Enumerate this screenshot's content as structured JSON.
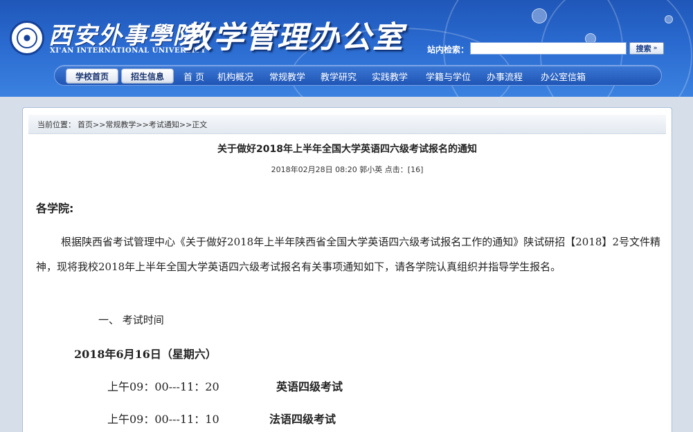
{
  "header": {
    "school_name_cn": "西安外事學院",
    "school_name_en": "XI'AN INTERNATIONAL UNIVERSITY",
    "office_title": "教学管理办公室",
    "search_label": "站内检索：",
    "search_value": "",
    "search_button": "搜索"
  },
  "nav": {
    "pills": [
      "学校首页",
      "招生信息"
    ],
    "items": [
      "首 页",
      "机构概况",
      "常规教学",
      "教学研究",
      "实践教学",
      "学籍与学位",
      "办事流程",
      "办公室信箱"
    ]
  },
  "breadcrumb": {
    "label": "当前位置：",
    "path": "首页>>常规教学>>考试通知>>正文"
  },
  "article": {
    "title": "关于做好2018年上半年全国大学英语四六级考试报名的通知",
    "meta": "2018年02月28日 08:20 郭小英 点击：[16]",
    "salutation": "各学院:",
    "paragraph": "根据陕西省考试管理中心《关于做好2018年上半年陕西省全国大学英语四六级考试报名工作的通知》陕试研招【2018】2号文件精神，现将我校2018年上半年全国大学英语四六级考试报名有关事项通知如下，请各学院认真组织并指导学生报名。",
    "section_1": "一、  考试时间",
    "exam_date": "2018年6月16日（星期六）",
    "schedule": [
      {
        "time": "上午09：00---11：20",
        "exam": "英语四级考试"
      },
      {
        "time": "上午09：00---11：10",
        "exam": "法语四级考试"
      }
    ]
  },
  "colors": {
    "banner_blue": "#2a6ad0",
    "nav_blue": "#1f55b4",
    "page_bg": "#d6deea"
  }
}
